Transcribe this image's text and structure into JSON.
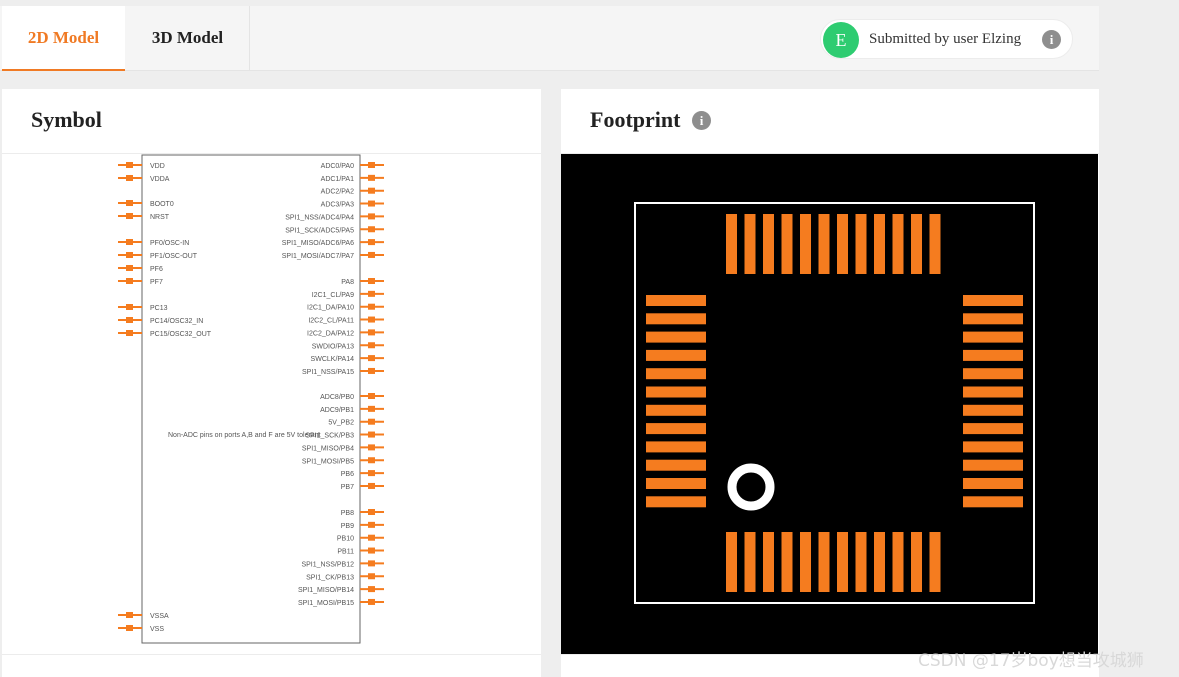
{
  "tabs": [
    {
      "label": "2D Model",
      "active": true
    },
    {
      "label": "3D Model",
      "active": false
    }
  ],
  "submitter": {
    "avatar_letter": "E",
    "text": "Submitted by user Elzing",
    "avatar_color": "#2ecc71",
    "info_icon": "info-icon"
  },
  "symbol_panel": {
    "title": "Symbol",
    "left_pins": [
      "VDD",
      "VDDA",
      "BOOT0",
      "NRST",
      "PF0/OSC-IN",
      "PF1/OSC-OUT",
      "PF6",
      "PF7",
      "PC13",
      "PC14/OSC32_IN",
      "PC15/OSC32_OUT",
      "VSSA",
      "VSS"
    ],
    "right_pins": [
      "ADC0/PA0",
      "ADC1/PA1",
      "ADC2/PA2",
      "ADC3/PA3",
      "SPI1_NSS/ADC4/PA4",
      "SPI1_SCK/ADC5/PA5",
      "SPI1_MISO/ADC6/PA6",
      "SPI1_MOSI/ADC7/PA7",
      "PA8",
      "I2C1_CL/PA9",
      "I2C1_DA/PA10",
      "I2C2_CL/PA11",
      "I2C2_DA/PA12",
      "SWDIO/PA13",
      "SWCLK/PA14",
      "SPI1_NSS/PA15",
      "ADC8/PB0",
      "ADC9/PB1",
      "5V_PB2",
      "SPI1_SCK/PB3",
      "SPI1_MISO/PB4",
      "SPI1_MOSI/PB5",
      "PB6",
      "PB7",
      "PB8",
      "PB9",
      "PB10",
      "PB11",
      "SPI1_NSS/PB12",
      "SPI1_CK/PB13",
      "SPI1_MISO/PB14",
      "SPI1_MOSI/PB15"
    ],
    "note": "Non-ADC pins on ports A,B and F are 5V tolerant"
  },
  "footprint_panel": {
    "title": "Footprint",
    "info_icon": "info-icon",
    "pads_per_side": 12,
    "pad_color": "#f57c1f",
    "background": "#000000",
    "outline_color": "#ffffff"
  },
  "watermark": "CSDN @17岁boy想当攻城狮"
}
